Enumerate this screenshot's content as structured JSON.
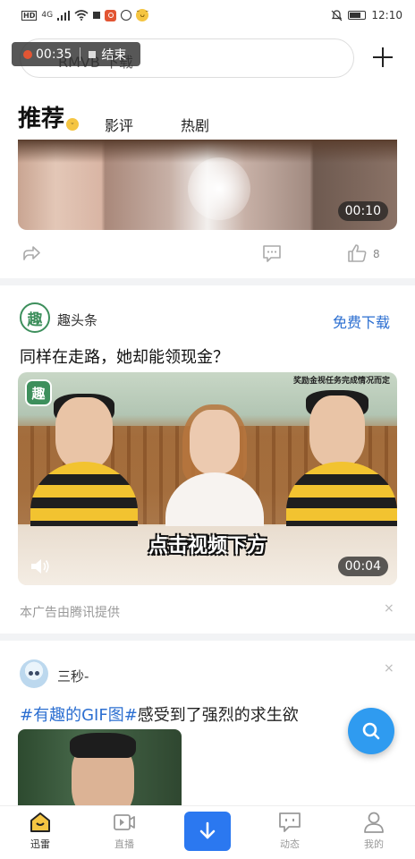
{
  "status_bar": {
    "network_label": "HD",
    "signal_label": "4G",
    "time": "12:10"
  },
  "recording": {
    "elapsed": "00:35",
    "end_label": "结束"
  },
  "search": {
    "text": "RMVB 下载"
  },
  "tabs": [
    {
      "label": "推荐",
      "active": true
    },
    {
      "label": "影评",
      "active": false
    },
    {
      "label": "热剧",
      "active": false
    }
  ],
  "feed": {
    "card1": {
      "duration": "00:10",
      "like_count": "8"
    },
    "ad_card": {
      "source_name": "趣头条",
      "logo_char": "趣",
      "cta_label": "免费下载",
      "title": "同样在走路，她却能领现金？",
      "corner_note": "奖励金视任务完成情况而定",
      "caption": "点击视频下方",
      "duration": "00:04",
      "ad_source": "本广告由腾讯提供",
      "close_label": "×"
    },
    "card3": {
      "user_name": "三秒-",
      "close_label": "×",
      "tag": "#有趣的GIF图#",
      "text": "感受到了强烈的求生欲"
    }
  },
  "bottom_nav": [
    {
      "label": "迅雷",
      "icon": "home-icon",
      "active": true
    },
    {
      "label": "直播",
      "icon": "live-icon",
      "active": false
    },
    {
      "label": "",
      "icon": "download-icon",
      "active": false
    },
    {
      "label": "动态",
      "icon": "message-icon",
      "active": false
    },
    {
      "label": "我的",
      "icon": "profile-icon",
      "active": false
    }
  ],
  "colors": {
    "accent_blue": "#2c6fd1",
    "download_button": "#2b78f0",
    "fab": "#2f9bf0",
    "ad_green": "#3d8f5c",
    "recording_red": "#e25533"
  }
}
